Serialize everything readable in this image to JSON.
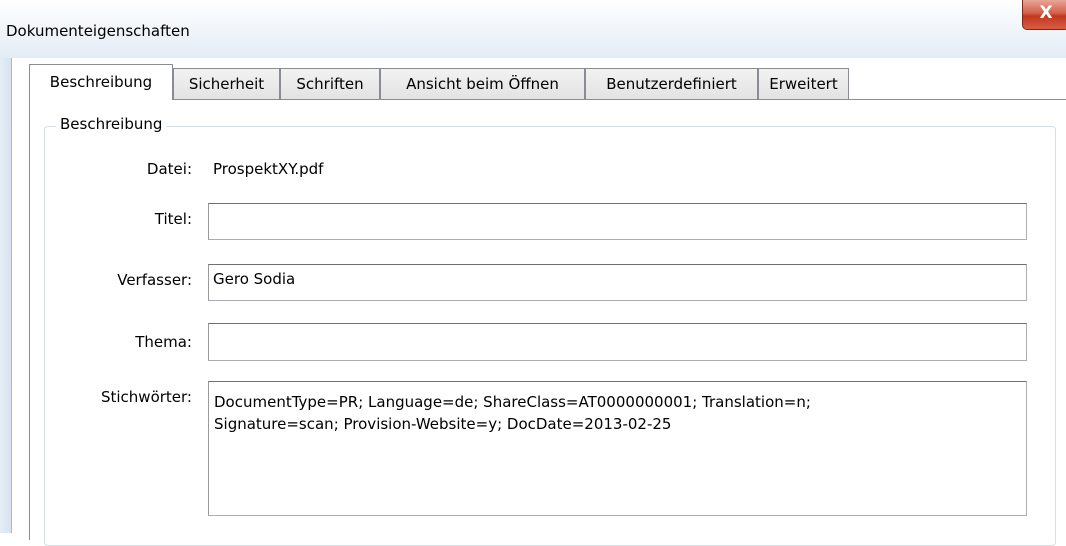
{
  "window": {
    "title": "Dokumenteigenschaften",
    "close_glyph": "X"
  },
  "tabs": [
    {
      "label": "Beschreibung",
      "active": true
    },
    {
      "label": "Sicherheit",
      "active": false
    },
    {
      "label": "Schriften",
      "active": false
    },
    {
      "label": "Ansicht beim Öffnen",
      "active": false
    },
    {
      "label": "Benutzerdefiniert",
      "active": false
    },
    {
      "label": "Erweitert",
      "active": false
    }
  ],
  "description": {
    "group_label": "Beschreibung",
    "file_label": "Datei:",
    "file_value": "ProspektXY.pdf",
    "title_label": "Titel:",
    "title_value": "",
    "author_label": "Verfasser:",
    "author_value": "Gero Sodia",
    "subject_label": "Thema:",
    "subject_value": "",
    "keywords_label": "Stichwörter:",
    "keywords_value": "DocumentType=PR; Language=de; ShareClass=AT0000000001; Translation=n;\nSignature=scan; Provision-Website=y; DocDate=2013-02-25"
  }
}
